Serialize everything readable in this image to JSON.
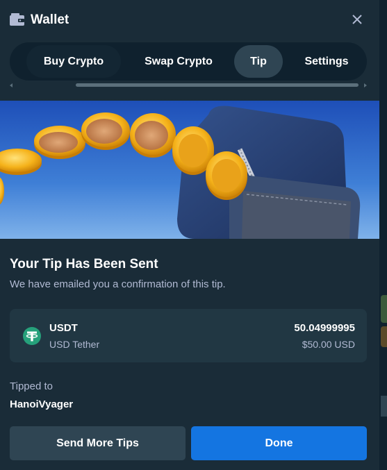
{
  "header": {
    "title": "Wallet",
    "icon": "wallet-icon",
    "close_icon": "close-icon"
  },
  "tabs": [
    {
      "label": "Buy Crypto",
      "active": false
    },
    {
      "label": "Swap Crypto",
      "active": false
    },
    {
      "label": "Tip",
      "active": true
    },
    {
      "label": "Settings",
      "active": false
    }
  ],
  "confirmation": {
    "title": "Your Tip Has Been Sent",
    "subtitle": "We have emailed you a confirmation of this tip."
  },
  "tip": {
    "currency_symbol": "USDT",
    "currency_name": "USD Tether",
    "amount": "50.04999995",
    "usd_value": "$50.00 USD",
    "currency_icon": "tether-icon"
  },
  "recipient": {
    "label": "Tipped to",
    "username": "HanoiVyager"
  },
  "actions": {
    "send_more": "Send More Tips",
    "done": "Done"
  },
  "colors": {
    "background": "#1a2c38",
    "card": "#213743",
    "accent_blue": "#1475e1",
    "secondary_button": "#2f4553",
    "tether_green": "#26a17b",
    "muted_text": "#b1bad3"
  }
}
